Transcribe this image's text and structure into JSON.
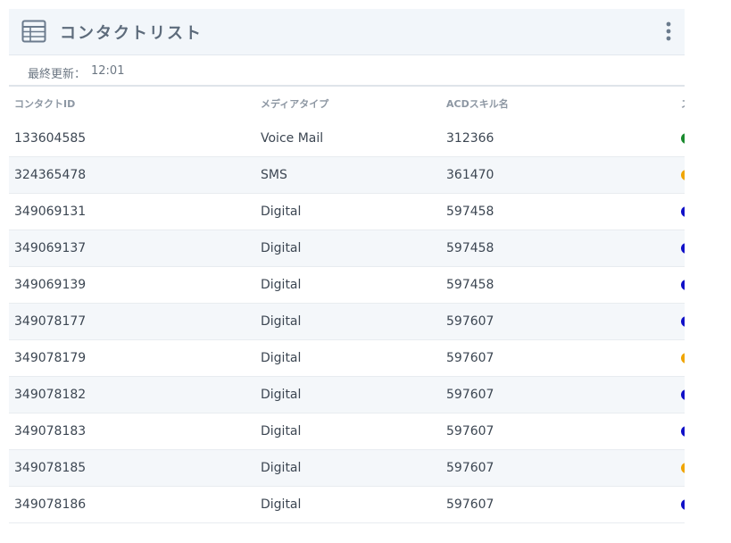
{
  "header": {
    "title": "コンタクトリスト",
    "grid_icon": "table-grid-icon",
    "menu_icon": "vertical-ellipsis-icon"
  },
  "updated": {
    "label": "最終更新：",
    "time": "12:01"
  },
  "table": {
    "columns": [
      "コンタクトID",
      "メディアタイプ",
      "ACDスキル名",
      "ス"
    ],
    "status_colors": {
      "green": "#1a8a2e",
      "orange": "#f0a500",
      "blue": "#1010c8"
    },
    "rows": [
      {
        "id": "133604585",
        "media": "Voice Mail",
        "skill": "312366",
        "status": "green"
      },
      {
        "id": "324365478",
        "media": "SMS",
        "skill": "361470",
        "status": "orange"
      },
      {
        "id": "349069131",
        "media": "Digital",
        "skill": "597458",
        "status": "blue"
      },
      {
        "id": "349069137",
        "media": "Digital",
        "skill": "597458",
        "status": "blue"
      },
      {
        "id": "349069139",
        "media": "Digital",
        "skill": "597458",
        "status": "blue"
      },
      {
        "id": "349078177",
        "media": "Digital",
        "skill": "597607",
        "status": "blue"
      },
      {
        "id": "349078179",
        "media": "Digital",
        "skill": "597607",
        "status": "orange"
      },
      {
        "id": "349078182",
        "media": "Digital",
        "skill": "597607",
        "status": "blue"
      },
      {
        "id": "349078183",
        "media": "Digital",
        "skill": "597607",
        "status": "blue"
      },
      {
        "id": "349078185",
        "media": "Digital",
        "skill": "597607",
        "status": "orange"
      },
      {
        "id": "349078186",
        "media": "Digital",
        "skill": "597607",
        "status": "blue"
      }
    ]
  }
}
